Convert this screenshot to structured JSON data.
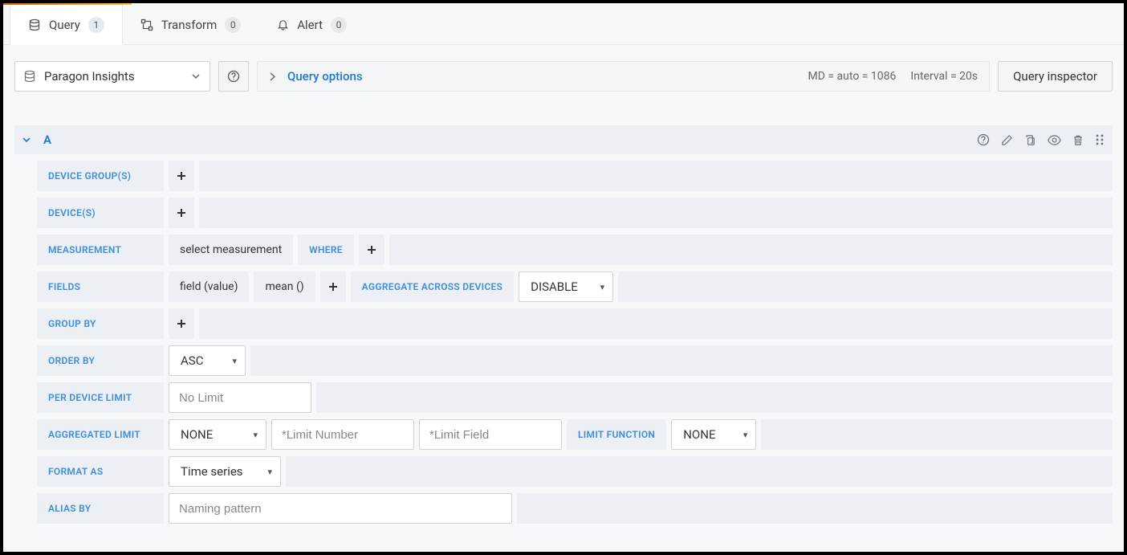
{
  "tabs": {
    "query": {
      "label": "Query",
      "count": "1"
    },
    "transform": {
      "label": "Transform",
      "count": "0"
    },
    "alert": {
      "label": "Alert",
      "count": "0"
    }
  },
  "toolbar": {
    "datasource": "Paragon Insights",
    "query_options_label": "Query options",
    "md_stat": "MD = auto = 1086",
    "interval_stat": "Interval = 20s",
    "inspector_label": "Query inspector"
  },
  "query": {
    "letter": "A",
    "labels": {
      "device_groups": "DEVICE GROUP(S)",
      "devices": "DEVICE(S)",
      "measurement": "MEASUREMENT",
      "where": "WHERE",
      "fields": "FIELDS",
      "aggregate_across": "AGGREGATE ACROSS DEVICES",
      "group_by": "GROUP BY",
      "order_by": "ORDER BY",
      "per_device_limit": "PER DEVICE LIMIT",
      "aggregated_limit": "AGGREGATED LIMIT",
      "limit_function": "LIMIT FUNCTION",
      "format_as": "FORMAT AS",
      "alias_by": "ALIAS BY"
    },
    "values": {
      "measurement_select": "select measurement",
      "field_value": "field (value)",
      "mean_fn": "mean ()",
      "aggregate_across": "DISABLE",
      "order_by": "ASC",
      "per_device_limit_placeholder": "No Limit",
      "agg_limit": "NONE",
      "limit_number_placeholder": "*Limit Number",
      "limit_field_placeholder": "*Limit Field",
      "limit_function": "NONE",
      "format_as": "Time series",
      "alias_placeholder": "Naming pattern"
    }
  }
}
